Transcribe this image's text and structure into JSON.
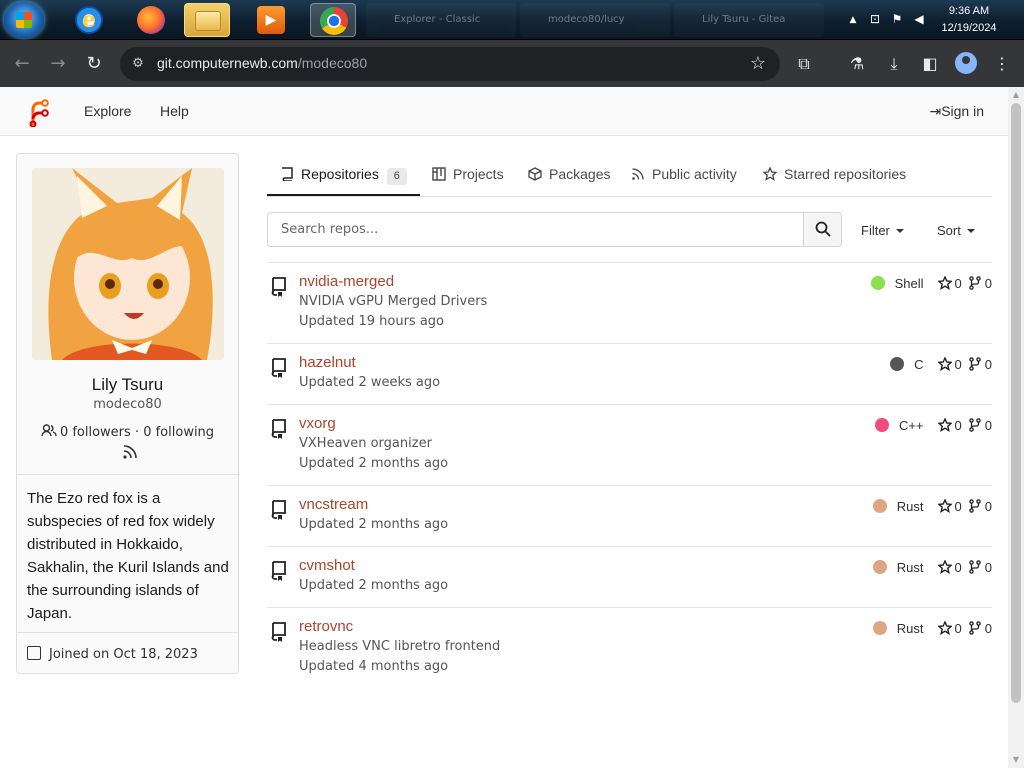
{
  "taskbar": {
    "tasks": [
      "Explorer - Classic",
      "modeco80/lucy",
      "Lily Tsuru - Gitea"
    ],
    "clock_time": "9:36 AM",
    "clock_date": "12/19/2024"
  },
  "browser": {
    "url_host": "git.computernewb.com",
    "url_path": "/modeco80"
  },
  "topnav": {
    "explore": "Explore",
    "help": "Help",
    "sign_in": "Sign in"
  },
  "profile": {
    "name": "Lily Tsuru",
    "handle": "modeco80",
    "followers": "0 followers",
    "following": "0 following",
    "bio": "The Ezo red fox is a subspecies of red fox widely distributed in Hokkaido, Sakhalin, the Kuril Islands and the surrounding islands of Japan.",
    "joined": "Joined on Oct 18, 2023"
  },
  "tabs": [
    {
      "label": "Repositories",
      "count": "6"
    },
    {
      "label": "Projects"
    },
    {
      "label": "Packages"
    },
    {
      "label": "Public activity"
    },
    {
      "label": "Starred repositories"
    }
  ],
  "search": {
    "placeholder": "Search repos...",
    "filter": "Filter",
    "sort": "Sort"
  },
  "repos": [
    {
      "name": "nvidia-merged",
      "description": "NVIDIA vGPU Merged Drivers",
      "updated": "Updated 19 hours ago",
      "language": "Shell",
      "lang_color": "#89e051",
      "stars": "0",
      "forks": "0"
    },
    {
      "name": "hazelnut",
      "description": "",
      "updated": "Updated 2 weeks ago",
      "language": "C",
      "lang_color": "#555555",
      "stars": "0",
      "forks": "0"
    },
    {
      "name": "vxorg",
      "description": "VXHeaven organizer",
      "updated": "Updated 2 months ago",
      "language": "C++",
      "lang_color": "#f34b7d",
      "stars": "0",
      "forks": "0"
    },
    {
      "name": "vncstream",
      "description": "",
      "updated": "Updated 2 months ago",
      "language": "Rust",
      "lang_color": "#dea584",
      "stars": "0",
      "forks": "0"
    },
    {
      "name": "cvmshot",
      "description": "",
      "updated": "Updated 2 months ago",
      "language": "Rust",
      "lang_color": "#dea584",
      "stars": "0",
      "forks": "0"
    },
    {
      "name": "retrovnc",
      "description": "Headless VNC libretro frontend",
      "updated": "Updated 4 months ago",
      "language": "Rust",
      "lang_color": "#dea584",
      "stars": "0",
      "forks": "0"
    }
  ]
}
